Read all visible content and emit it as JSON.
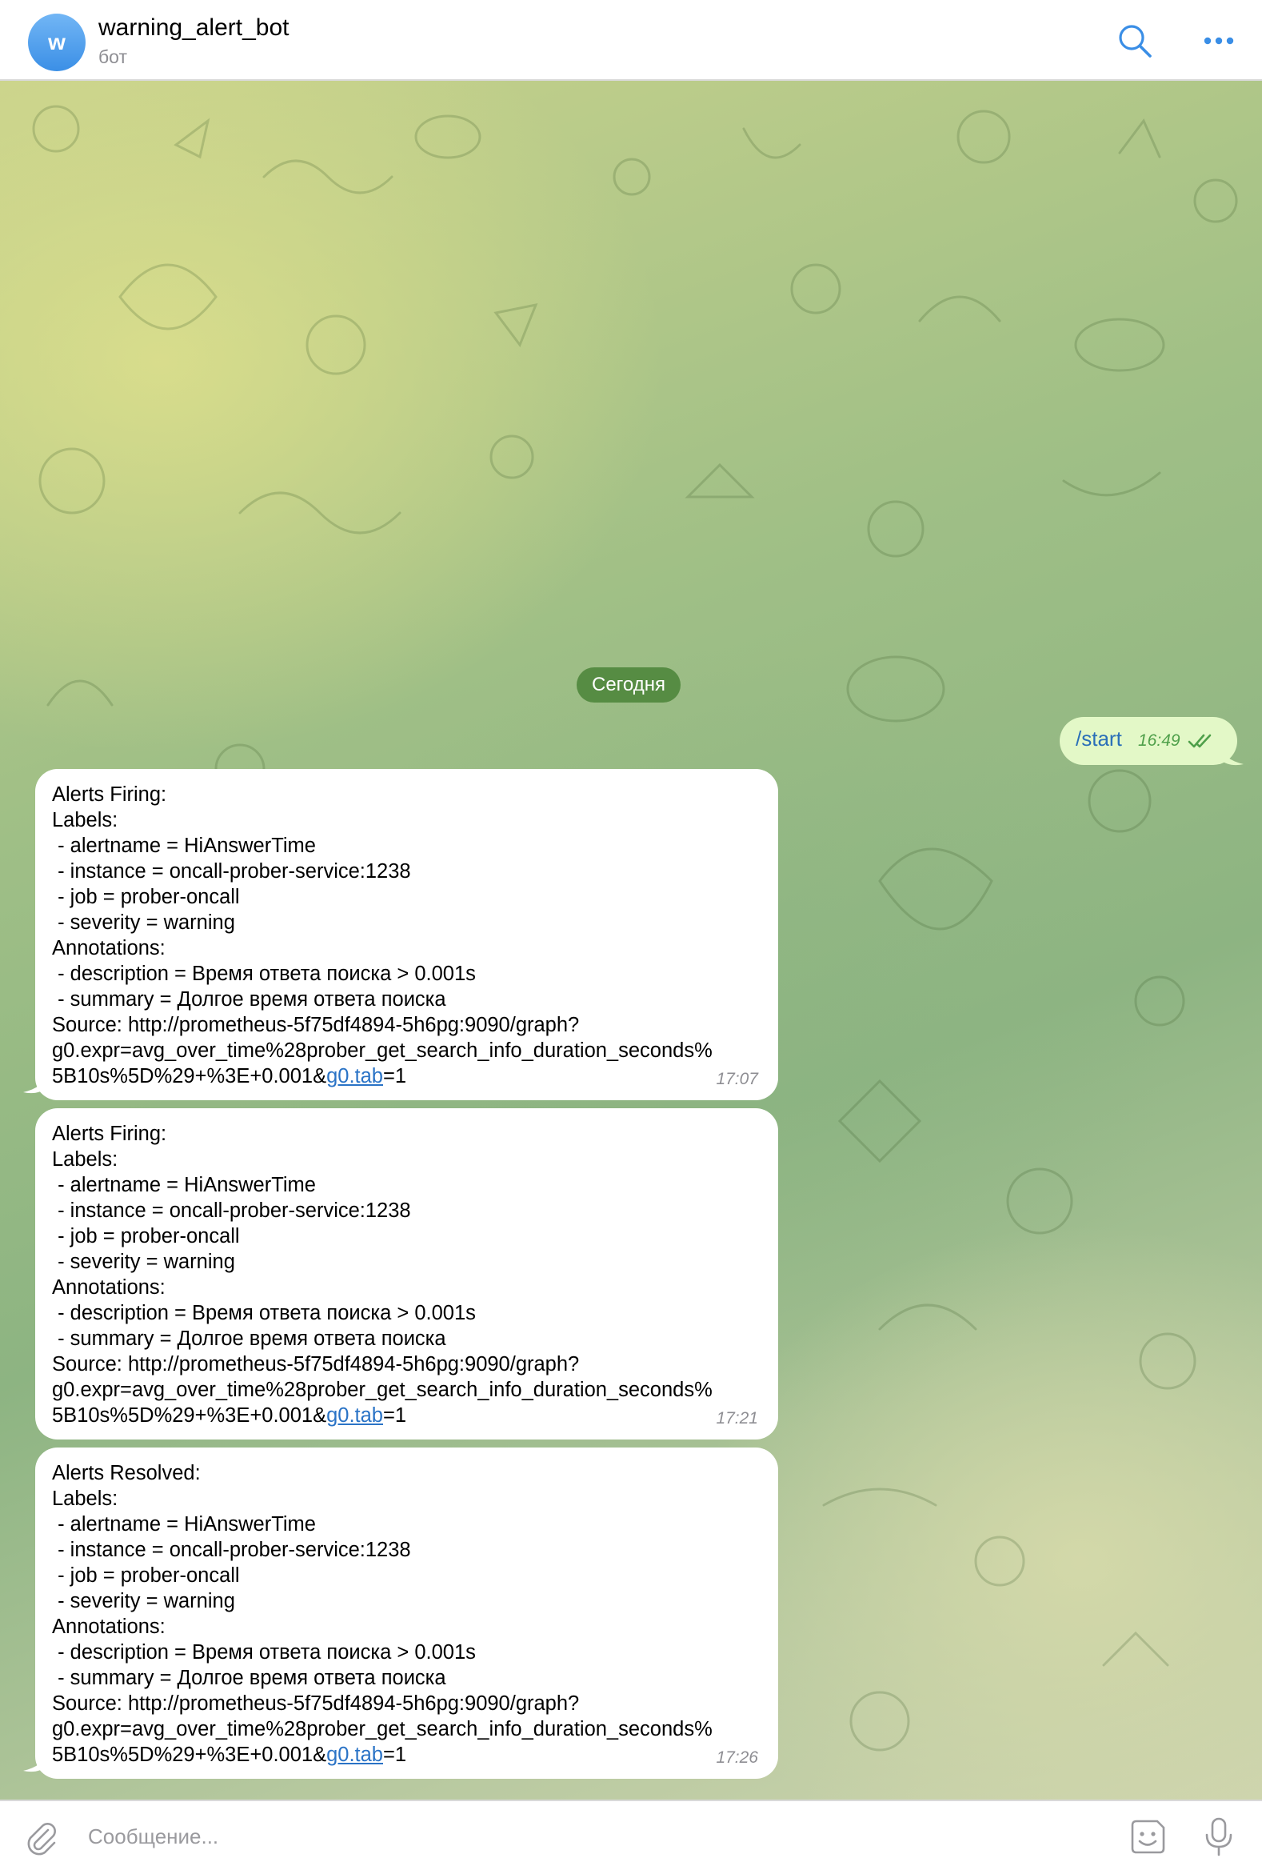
{
  "header": {
    "avatar_letter": "w",
    "title": "warning_alert_bot",
    "subtitle": "бот",
    "search_icon": "search-icon",
    "more_icon": "more-icon"
  },
  "date_separator": "Сегодня",
  "outgoing": {
    "text": "/start",
    "time": "16:49",
    "status_icon": "double-check-icon"
  },
  "messages": [
    {
      "heading": "Alerts Firing:",
      "body": "Labels:\n - alertname = HiAnswerTime\n - instance = oncall-prober-service:1238\n - job = prober-oncall\n - severity = warning\nAnnotations:\n - description = Время ответа поиска > 0.001s\n - summary = Долгое время ответа поиска\nSource: http://prometheus-5f75df4894-5h6pg:9090/graph?\ng0.expr=avg_over_time%28prober_get_search_info_duration_seconds%\n5B10s%5D%29+%3E+0.001&",
      "link": "g0.tab",
      "after_link": "=1",
      "time": "17:07"
    },
    {
      "heading": "Alerts Firing:",
      "body": "Labels:\n - alertname = HiAnswerTime\n - instance = oncall-prober-service:1238\n - job = prober-oncall\n - severity = warning\nAnnotations:\n - description = Время ответа поиска > 0.001s\n - summary = Долгое время ответа поиска\nSource: http://prometheus-5f75df4894-5h6pg:9090/graph?\ng0.expr=avg_over_time%28prober_get_search_info_duration_seconds%\n5B10s%5D%29+%3E+0.001&",
      "link": "g0.tab",
      "after_link": "=1",
      "time": "17:21"
    },
    {
      "heading": "Alerts Resolved:",
      "body": "Labels:\n - alertname = HiAnswerTime\n - instance = oncall-prober-service:1238\n - job = prober-oncall\n - severity = warning\nAnnotations:\n - description = Время ответа поиска > 0.001s\n - summary = Долгое время ответа поиска\nSource: http://prometheus-5f75df4894-5h6pg:9090/graph?\ng0.expr=avg_over_time%28prober_get_search_info_duration_seconds%\n5B10s%5D%29+%3E+0.001&",
      "link": "g0.tab",
      "after_link": "=1",
      "time": "17:26"
    }
  ],
  "input": {
    "placeholder": "Сообщение...",
    "value": "",
    "attach_icon": "paperclip-icon",
    "sticker_icon": "sticker-icon",
    "mic_icon": "microphone-icon"
  },
  "colors": {
    "outgoing_bubble": "#e3f8c7",
    "incoming_bubble": "#ffffff",
    "date_pill": "#4f863c",
    "link": "#2a73c6",
    "accent_blue": "#3a8ee6",
    "avatar_gradient_top": "#72b6f5",
    "avatar_gradient_bottom": "#3b8fe6"
  }
}
